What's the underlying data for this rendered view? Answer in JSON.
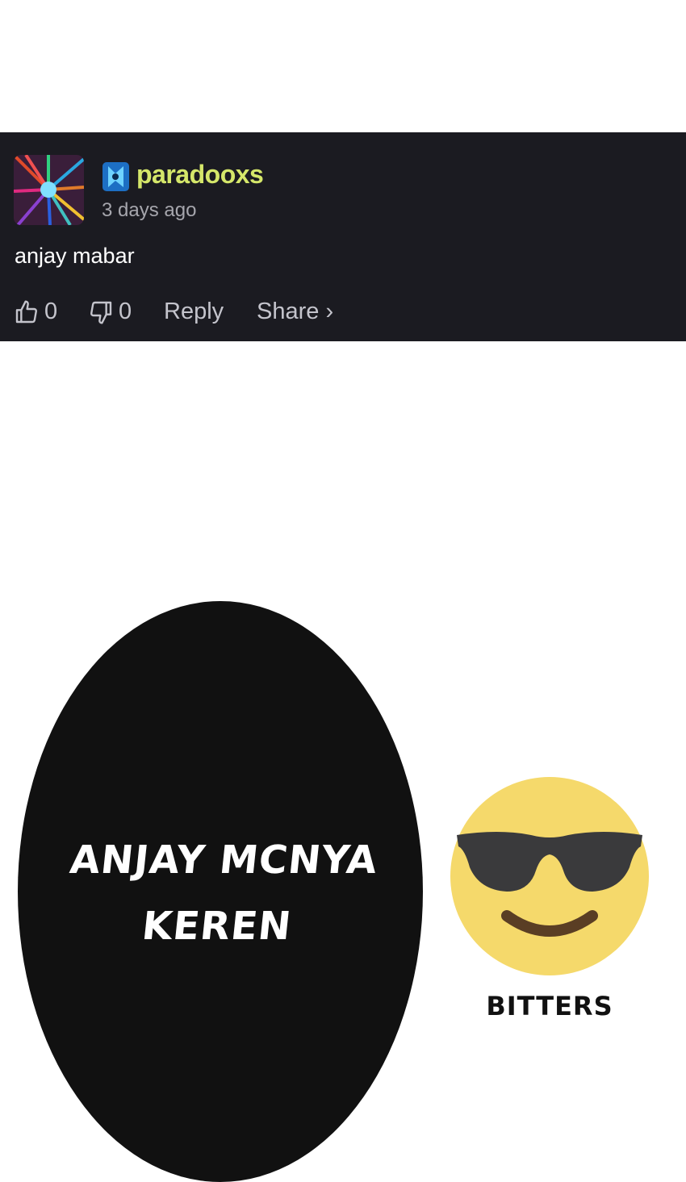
{
  "comment": {
    "username": "paradooxs",
    "timestamp": "3 days ago",
    "text": "anjay mabar",
    "likes": "0",
    "dislikes": "0",
    "reply_label": "Reply",
    "share_label": "Share ›"
  },
  "panel": {
    "bubble_line1": "ANJAY MCNYA",
    "bubble_line2": "KEREN",
    "caption": "BITTERS"
  },
  "icons": {
    "avatar": "abstract-avatar-image",
    "badge": "blue-badge-icon",
    "like": "thumbs-up-icon",
    "dislike": "thumbs-down-icon",
    "emoji": "sunglasses-smiley-emoji"
  },
  "colors": {
    "card_bg": "#1b1b21",
    "username": "#d5e76a",
    "emoji_face": "#f5d96b",
    "glasses": "#3a3a3c",
    "mouth": "#5a3e24"
  }
}
